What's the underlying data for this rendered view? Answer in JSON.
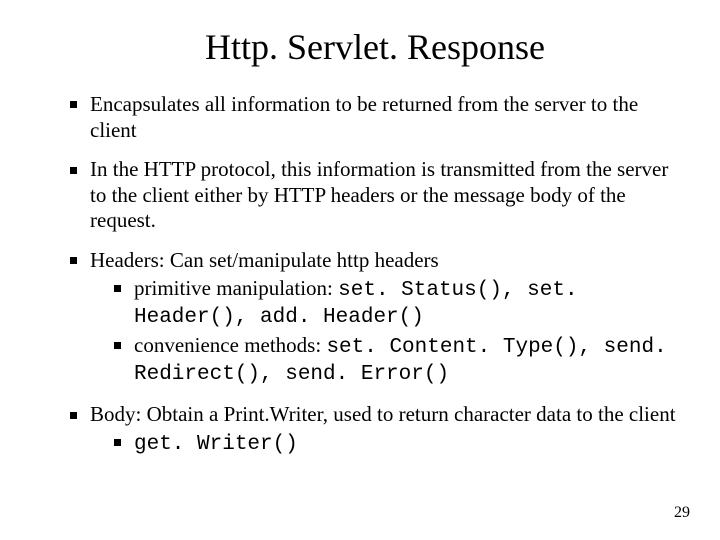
{
  "title": "Http. Servlet. Response",
  "bullets": {
    "b1": "Encapsulates all information to be returned from the server to the client",
    "b2": "In the HTTP protocol, this information is transmitted from the server to the client either by HTTP headers or the message body of the request.",
    "b3": "Headers: Can set/manipulate http headers",
    "b3a_lead": "primitive manipulation: ",
    "b3a_code": "set. Status(), set. Header(), add. Header()",
    "b3b_lead": "convenience methods: ",
    "b3b_code": "set. Content. Type(), send. Redirect(), send. Error()",
    "b4": "Body:   Obtain a Print.Writer, used to return character data to the client",
    "b4a_code": "get. Writer()"
  },
  "page_number": "29"
}
